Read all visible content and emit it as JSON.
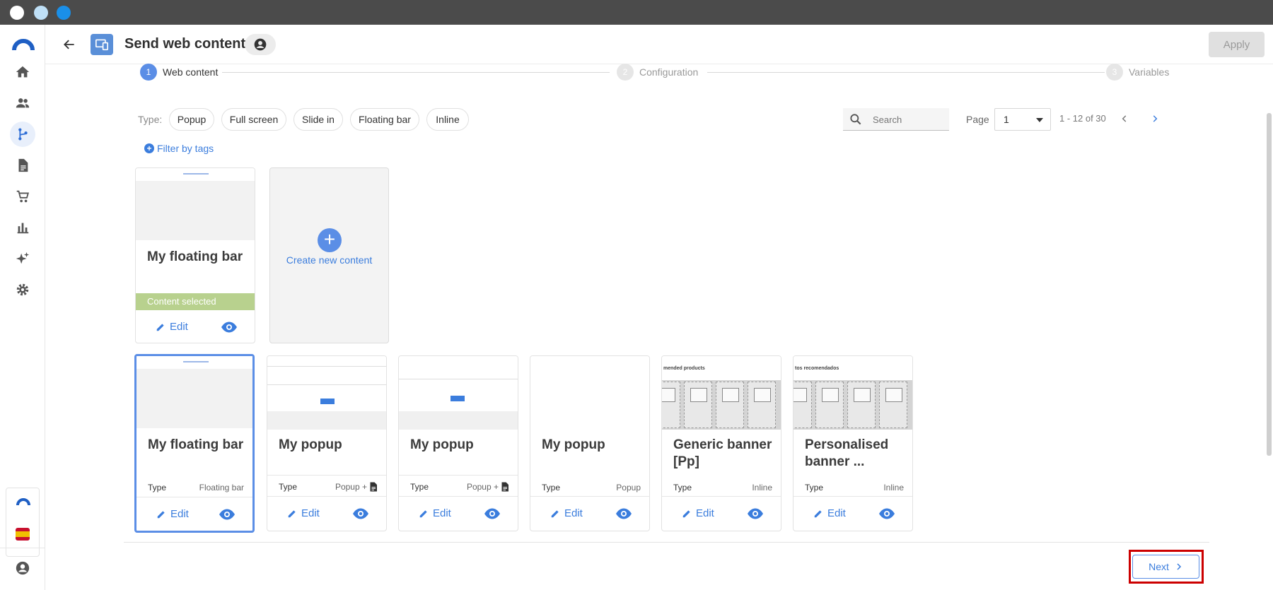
{
  "window": {
    "dots": [
      "#ffffff",
      "#bfe0f7",
      "#1a8fe8"
    ]
  },
  "header": {
    "title": "Send web content",
    "apply_label": "Apply"
  },
  "stepper": {
    "steps": [
      {
        "number": "1",
        "label": "Web content"
      },
      {
        "number": "2",
        "label": "Configuration"
      },
      {
        "number": "3",
        "label": "Variables"
      }
    ]
  },
  "filters": {
    "type_label": "Type:",
    "types": [
      "Popup",
      "Full screen",
      "Slide in",
      "Floating bar",
      "Inline"
    ],
    "filter_by_tags": "Filter by tags"
  },
  "search": {
    "placeholder": "Search"
  },
  "pagination": {
    "page_label": "Page",
    "page_value": "1",
    "range": "1 - 12 of 30"
  },
  "selected_card": {
    "title": "My floating bar",
    "status": "Content selected",
    "edit_label": "Edit"
  },
  "create_card": {
    "label": "Create new content"
  },
  "cards": [
    {
      "title": "My floating bar",
      "type_label": "Type",
      "type_value": "Floating bar",
      "edit_label": "Edit"
    },
    {
      "title": "My popup",
      "type_label": "Type",
      "type_value": "Popup +",
      "edit_label": "Edit"
    },
    {
      "title": "My popup",
      "type_label": "Type",
      "type_value": "Popup +",
      "edit_label": "Edit"
    },
    {
      "title": "My popup",
      "type_label": "Type",
      "type_value": "Popup",
      "edit_label": "Edit"
    },
    {
      "title": "Generic banner [Pp]",
      "type_label": "Type",
      "type_value": "Inline",
      "edit_label": "Edit",
      "thumb_heading": "mended products"
    },
    {
      "title": "Personalised banner ...",
      "type_label": "Type",
      "type_value": "Inline",
      "edit_label": "Edit",
      "thumb_heading": "tos recomendados"
    }
  ],
  "footer": {
    "next_label": "Next"
  },
  "colors": {
    "accent": "#3b7ddd",
    "selected_green": "#b8d18e",
    "highlight_red": "#cc0000"
  }
}
